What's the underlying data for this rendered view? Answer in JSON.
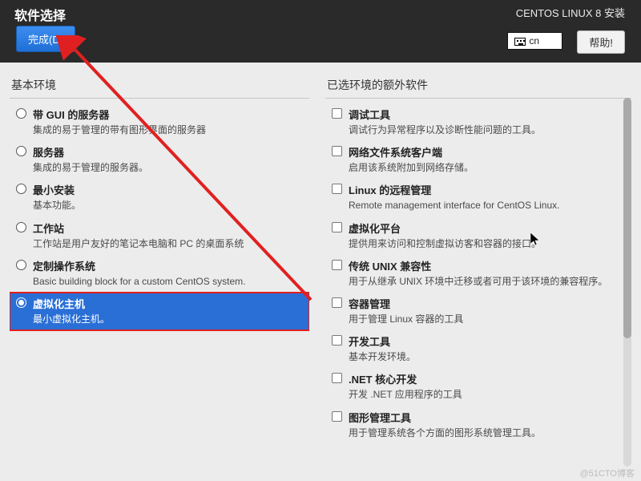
{
  "header": {
    "page_title": "软件选择",
    "app_title": "CENTOS LINUX 8 安装",
    "done_label": "完成(D)",
    "locale": "cn",
    "help_label": "帮助!"
  },
  "left": {
    "heading": "基本环境",
    "items": [
      {
        "title": "带 GUI 的服务器",
        "desc": "集成的易于管理的带有图形界面的服务器",
        "selected": false
      },
      {
        "title": "服务器",
        "desc": "集成的易于管理的服务器。",
        "selected": false
      },
      {
        "title": "最小安装",
        "desc": "基本功能。",
        "selected": false
      },
      {
        "title": "工作站",
        "desc": "工作站是用户友好的笔记本电脑和 PC 的桌面系统",
        "selected": false
      },
      {
        "title": "定制操作系统",
        "desc": "Basic building block for a custom CentOS system.",
        "selected": false
      },
      {
        "title": "虚拟化主机",
        "desc": "最小虚拟化主机。",
        "selected": true
      }
    ]
  },
  "right": {
    "heading": "已选环境的额外软件",
    "items": [
      {
        "title": "调试工具",
        "desc": "调试行为异常程序以及诊断性能问题的工具。"
      },
      {
        "title": "网络文件系统客户端",
        "desc": "启用该系统附加到网络存储。"
      },
      {
        "title": "Linux 的远程管理",
        "desc": "Remote management interface for CentOS Linux."
      },
      {
        "title": "虚拟化平台",
        "desc": "提供用来访问和控制虚拟访客和容器的接口。"
      },
      {
        "title": "传统 UNIX 兼容性",
        "desc": "用于从继承 UNIX 环境中迁移或者可用于该环境的兼容程序。"
      },
      {
        "title": "容器管理",
        "desc": "用于管理 Linux 容器的工具"
      },
      {
        "title": "开发工具",
        "desc": "基本开发环境。"
      },
      {
        "title": ".NET 核心开发",
        "desc": "开发 .NET 应用程序的工具"
      },
      {
        "title": "图形管理工具",
        "desc": "用于管理系统各个方面的图形系统管理工具。"
      }
    ]
  },
  "watermark": "@51CTO博客"
}
